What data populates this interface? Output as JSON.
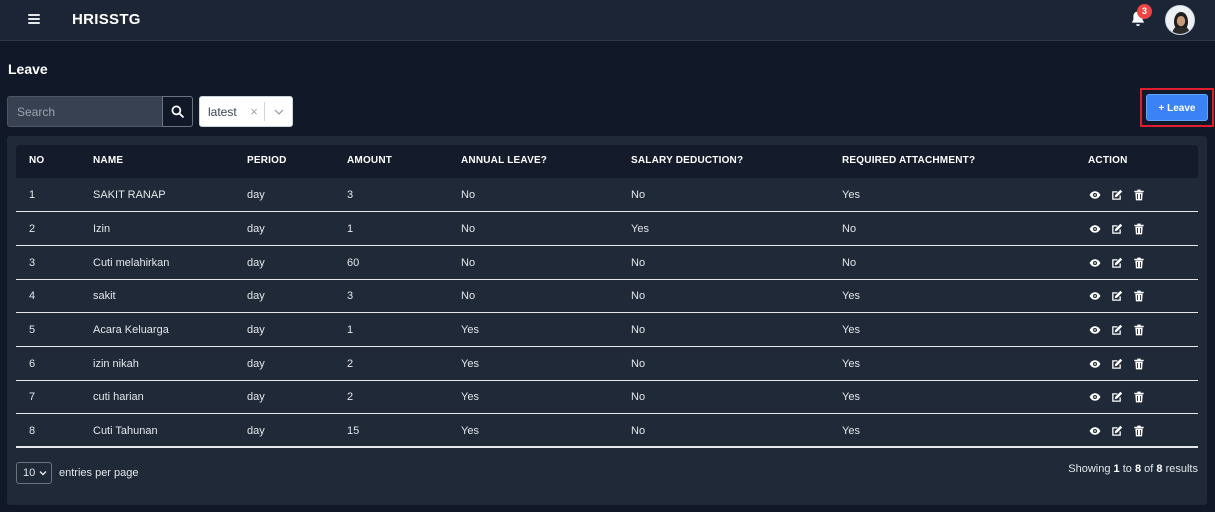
{
  "header": {
    "brand": "HRISSTG",
    "notification_count": "3"
  },
  "page": {
    "title": "Leave"
  },
  "toolbar": {
    "search_placeholder": "Search",
    "sort_value": "latest",
    "clear_glyph": "×",
    "add_label": "+ Leave"
  },
  "table": {
    "columns": [
      "NO",
      "NAME",
      "PERIOD",
      "AMOUNT",
      "ANNUAL LEAVE?",
      "SALARY DEDUCTION?",
      "REQUIRED ATTACHMENT?",
      "ACTION"
    ],
    "rows": [
      {
        "no": "1",
        "name": "SAKIT RANAP",
        "period": "day",
        "amount": "3",
        "annual": "No",
        "salary": "No",
        "attachment": "Yes"
      },
      {
        "no": "2",
        "name": "Izin",
        "period": "day",
        "amount": "1",
        "annual": "No",
        "salary": "Yes",
        "attachment": "No"
      },
      {
        "no": "3",
        "name": "Cuti melahirkan",
        "period": "day",
        "amount": "60",
        "annual": "No",
        "salary": "No",
        "attachment": "No"
      },
      {
        "no": "4",
        "name": "sakit",
        "period": "day",
        "amount": "3",
        "annual": "No",
        "salary": "No",
        "attachment": "Yes"
      },
      {
        "no": "5",
        "name": "Acara Keluarga",
        "period": "day",
        "amount": "1",
        "annual": "Yes",
        "salary": "No",
        "attachment": "Yes"
      },
      {
        "no": "6",
        "name": "izin nikah",
        "period": "day",
        "amount": "2",
        "annual": "Yes",
        "salary": "No",
        "attachment": "Yes"
      },
      {
        "no": "7",
        "name": "cuti harian",
        "period": "day",
        "amount": "2",
        "annual": "Yes",
        "salary": "No",
        "attachment": "Yes"
      },
      {
        "no": "8",
        "name": "Cuti Tahunan",
        "period": "day",
        "amount": "15",
        "annual": "Yes",
        "salary": "No",
        "attachment": "Yes"
      }
    ],
    "row_actions": [
      "eye-icon",
      "edit-icon",
      "trash-icon"
    ]
  },
  "footer": {
    "per_page_value": "10",
    "per_page_label": "entries per page",
    "showing_prefix": "Showing",
    "showing_from": "1",
    "showing_to_word": "to",
    "showing_to": "8",
    "showing_of_word": "of",
    "showing_total": "8",
    "showing_suffix": "results"
  },
  "colors": {
    "background": "#111827",
    "topbar": "#1b2536",
    "card": "#1f2937",
    "accent": "#3b82f6",
    "highlight": "#e11d2e",
    "badge": "#ef4444"
  }
}
